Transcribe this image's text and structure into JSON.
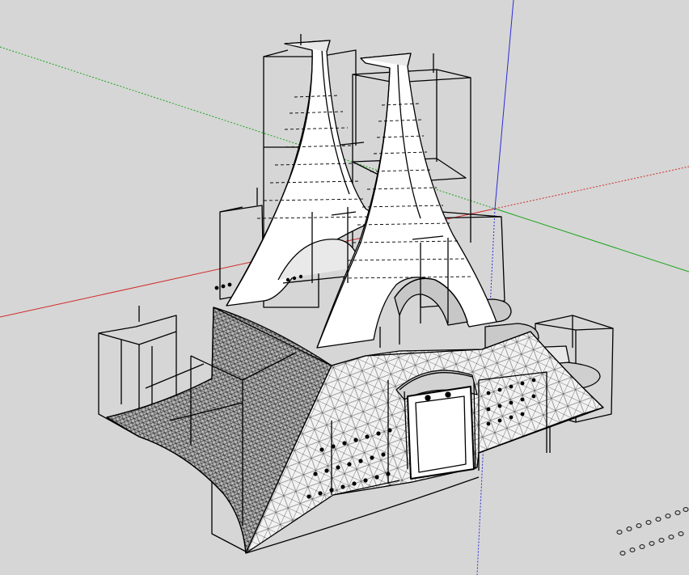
{
  "app": {
    "canvas_background": "#d6d6d6"
  },
  "axes": {
    "red_axis_color": "#d22a2a",
    "green_axis_color": "#1aa51a",
    "blue_axis_color": "#2b2bd8"
  },
  "model": {
    "face_color": "#ffffff",
    "shade_color": "#c9c9c9",
    "edge_color": "#000000"
  }
}
